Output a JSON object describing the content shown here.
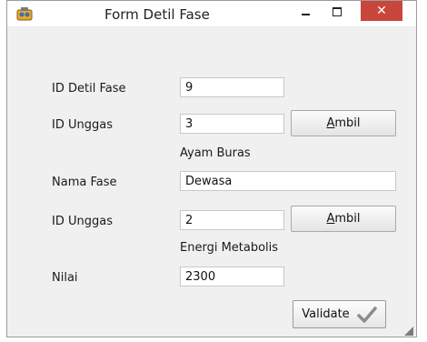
{
  "window": {
    "title": "Form Detil Fase",
    "close_glyph": "✕"
  },
  "form": {
    "id_detil_fase": {
      "label": "ID Detil Fase",
      "value": "9"
    },
    "id_unggas_1": {
      "label": "ID Unggas",
      "value": "3",
      "button_pre": "",
      "button_accel": "A",
      "button_post": "mbil",
      "name": "Ayam Buras"
    },
    "nama_fase": {
      "label": "Nama Fase",
      "value": "Dewasa"
    },
    "id_unggas_2": {
      "label": "ID Unggas",
      "value": "2",
      "button_pre": "",
      "button_accel": "A",
      "button_post": "mbil",
      "name": "Energi Metabolis"
    },
    "nilai": {
      "label": "Nilai",
      "value": "2300"
    },
    "validate_label": "Validate"
  },
  "icons": {
    "app": "app-icon",
    "check": "checkmark-icon",
    "grip": "resize-grip-icon"
  },
  "colors": {
    "close_button": "#c9463c",
    "window_bg": "#f0f0f0",
    "checkmark": "#8c8c8c"
  }
}
